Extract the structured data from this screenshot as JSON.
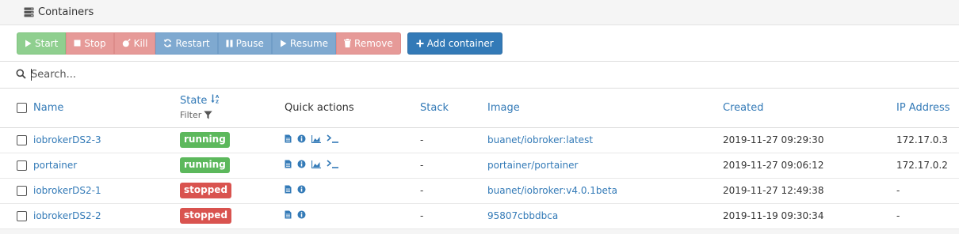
{
  "panel": {
    "title": "Containers"
  },
  "toolbar": {
    "start": "Start",
    "stop": "Stop",
    "kill": "Kill",
    "restart": "Restart",
    "pause": "Pause",
    "resume": "Resume",
    "remove": "Remove",
    "add_container": "Add container"
  },
  "search": {
    "placeholder": "Search..."
  },
  "table": {
    "headers": {
      "name": "Name",
      "state": "State",
      "filter": "Filter",
      "quick_actions": "Quick actions",
      "stack": "Stack",
      "image": "Image",
      "created": "Created",
      "ip": "IP Address"
    },
    "rows": [
      {
        "name": "iobrokerDS2-3",
        "state": "running",
        "stack": "-",
        "image": "buanet/iobroker:latest",
        "created": "2019-11-27 09:29:30",
        "ip": "172.17.0.3"
      },
      {
        "name": "portainer",
        "state": "running",
        "stack": "-",
        "image": "portainer/portainer",
        "created": "2019-11-27 09:06:12",
        "ip": "172.17.0.2"
      },
      {
        "name": "iobrokerDS2-1",
        "state": "stopped",
        "stack": "-",
        "image": "buanet/iobroker:v4.0.1beta",
        "created": "2019-11-27 12:49:38",
        "ip": "-"
      },
      {
        "name": "iobrokerDS2-2",
        "state": "stopped",
        "stack": "-",
        "image": "95807cbbdbca",
        "created": "2019-11-19 09:30:34",
        "ip": "-"
      }
    ]
  },
  "colors": {
    "success": "#5cb85c",
    "danger": "#d9534f",
    "primary": "#337ab7"
  },
  "icons": {
    "header": "server-icon",
    "quick_actions_running": [
      "logs-icon",
      "info-icon",
      "stats-icon",
      "console-icon"
    ],
    "quick_actions_stopped": [
      "logs-icon",
      "info-icon"
    ]
  }
}
